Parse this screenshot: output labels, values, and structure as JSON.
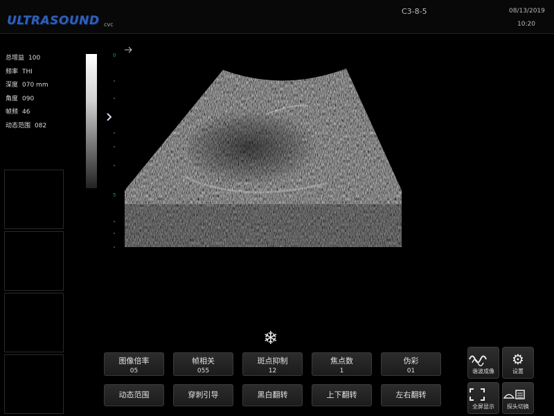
{
  "header": {
    "logo": "ULTRASOUND",
    "preset": "cvc",
    "probe": "C3-8-5",
    "date": "08/13/2019",
    "time": "10:20"
  },
  "params": [
    {
      "label": "总增益",
      "value": "100"
    },
    {
      "label": "频率",
      "value": "THI"
    },
    {
      "label": "深度",
      "value": "070 mm"
    },
    {
      "label": "角度",
      "value": "090"
    },
    {
      "label": "帧频",
      "value": "46"
    },
    {
      "label": "动态范围",
      "value": "082"
    }
  ],
  "freeze_icon": "snowflake-icon",
  "buttons_top": [
    {
      "label": "图像倍率",
      "value": "05"
    },
    {
      "label": "帧相关",
      "value": "055"
    },
    {
      "label": "斑点抑制",
      "value": "12"
    },
    {
      "label": "焦点数",
      "value": "1"
    },
    {
      "label": "伪彩",
      "value": "01"
    }
  ],
  "buttons_bottom": [
    {
      "label": "动态范围"
    },
    {
      "label": "穿刺引导"
    },
    {
      "label": "黑白翻转"
    },
    {
      "label": "上下翻转"
    },
    {
      "label": "左右翻转"
    }
  ],
  "side_buttons": [
    {
      "label": "谐波成像",
      "icon": "harmonic-wave-icon"
    },
    {
      "label": "设置",
      "icon": "gear-icon"
    },
    {
      "label": "全屏显示",
      "icon": "fullscreen-icon"
    },
    {
      "label": "探头切换",
      "icon": "probe-switch-icon"
    }
  ]
}
